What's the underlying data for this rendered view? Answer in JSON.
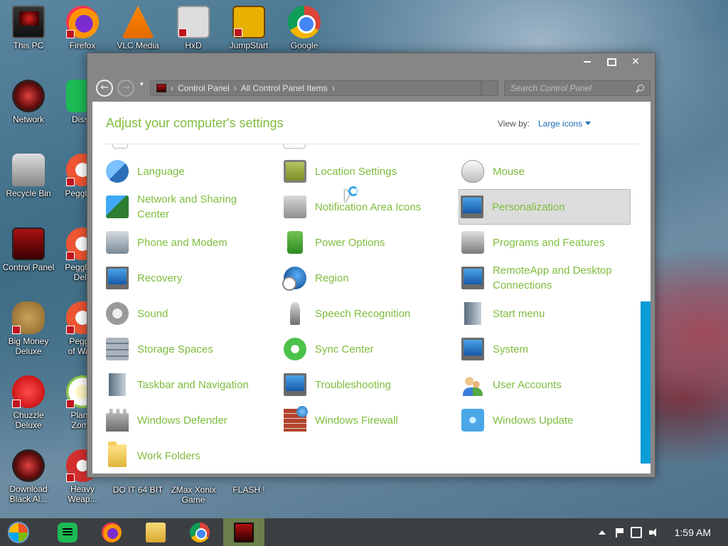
{
  "desktop": {
    "icons": [
      {
        "label": "This PC"
      },
      {
        "label": "Firefox"
      },
      {
        "label": "VLC Media"
      },
      {
        "label": "HxD"
      },
      {
        "label": "JumpStart"
      },
      {
        "label": "Google"
      },
      {
        "label": "Network"
      },
      {
        "label": "Disse"
      },
      {
        "label": "Recycle Bin"
      },
      {
        "label": "Peggle D"
      },
      {
        "label": "Control Panel"
      },
      {
        "label": "Peggle N"
      },
      {
        "label": "Delu"
      },
      {
        "label": "Big Money"
      },
      {
        "label": "Deluxe"
      },
      {
        "label": "Peggle"
      },
      {
        "label": "of Warc"
      },
      {
        "label": "Chuzzle"
      },
      {
        "label": "Deluxe"
      },
      {
        "label": "Plants"
      },
      {
        "label": "Zomb"
      },
      {
        "label": "Download"
      },
      {
        "label": "Black Al..."
      },
      {
        "label": "Heavy"
      },
      {
        "label": "Weap..."
      },
      {
        "label": "DO IT 64 BIT"
      },
      {
        "label": "ZMax Xonix"
      },
      {
        "label": "Game"
      },
      {
        "label": "FLASH !"
      }
    ]
  },
  "window": {
    "controls": {
      "minimize": "",
      "maximize": "",
      "close": "✕"
    },
    "nav": {
      "back": "←",
      "forward": "→",
      "recent": "▾"
    },
    "breadcrumb": [
      "Control Panel",
      "All Control Panel Items"
    ],
    "breadcrumb_sep": "›",
    "search_placeholder": "Search Control Panel",
    "title": "Adjust your computer's settings",
    "view_by_label": "View by:",
    "view_by_value": "Large icons",
    "items": [
      {
        "label": "Language",
        "icon": "language-icon"
      },
      {
        "label": "Location Settings",
        "icon": "location-settings-icon"
      },
      {
        "label": "Mouse",
        "icon": "mouse-icon"
      },
      {
        "label": "Network and Sharing Center",
        "icon": "network-sharing-icon"
      },
      {
        "label": "Notification Area Icons",
        "icon": "notification-area-icon"
      },
      {
        "label": "Personalization",
        "icon": "personalization-icon"
      },
      {
        "label": "Phone and Modem",
        "icon": "phone-modem-icon"
      },
      {
        "label": "Power Options",
        "icon": "power-options-icon"
      },
      {
        "label": "Programs and Features",
        "icon": "programs-features-icon"
      },
      {
        "label": "Recovery",
        "icon": "recovery-icon"
      },
      {
        "label": "Region",
        "icon": "region-icon"
      },
      {
        "label": "RemoteApp and Desktop Connections",
        "icon": "remoteapp-icon"
      },
      {
        "label": "Sound",
        "icon": "sound-icon"
      },
      {
        "label": "Speech Recognition",
        "icon": "speech-recognition-icon"
      },
      {
        "label": "Start menu",
        "icon": "start-menu-icon"
      },
      {
        "label": "Storage Spaces",
        "icon": "storage-spaces-icon"
      },
      {
        "label": "Sync Center",
        "icon": "sync-center-icon"
      },
      {
        "label": "System",
        "icon": "system-icon"
      },
      {
        "label": "Taskbar and Navigation",
        "icon": "taskbar-navigation-icon"
      },
      {
        "label": "Troubleshooting",
        "icon": "troubleshooting-icon"
      },
      {
        "label": "User Accounts",
        "icon": "user-accounts-icon"
      },
      {
        "label": "Windows Defender",
        "icon": "windows-defender-icon"
      },
      {
        "label": "Windows Firewall",
        "icon": "windows-firewall-icon"
      },
      {
        "label": "Windows Update",
        "icon": "windows-update-icon"
      },
      {
        "label": "Work Folders",
        "icon": "work-folders-icon"
      }
    ],
    "selected_item": "Personalization"
  },
  "taskbar": {
    "apps": [
      "start-orb-icon",
      "notes-app-icon",
      "firefox-icon",
      "file-explorer-icon",
      "chrome-icon",
      "control-panel-icon"
    ],
    "active_app": "control-panel-icon",
    "clock": "1:59 AM"
  },
  "colors": {
    "accent_green": "#7ebd3d",
    "link_blue": "#1e6bb5",
    "scrollbar": "#0a9dd8",
    "taskbar": "#3b3f42",
    "active_taskbar": "#6c7e49"
  }
}
